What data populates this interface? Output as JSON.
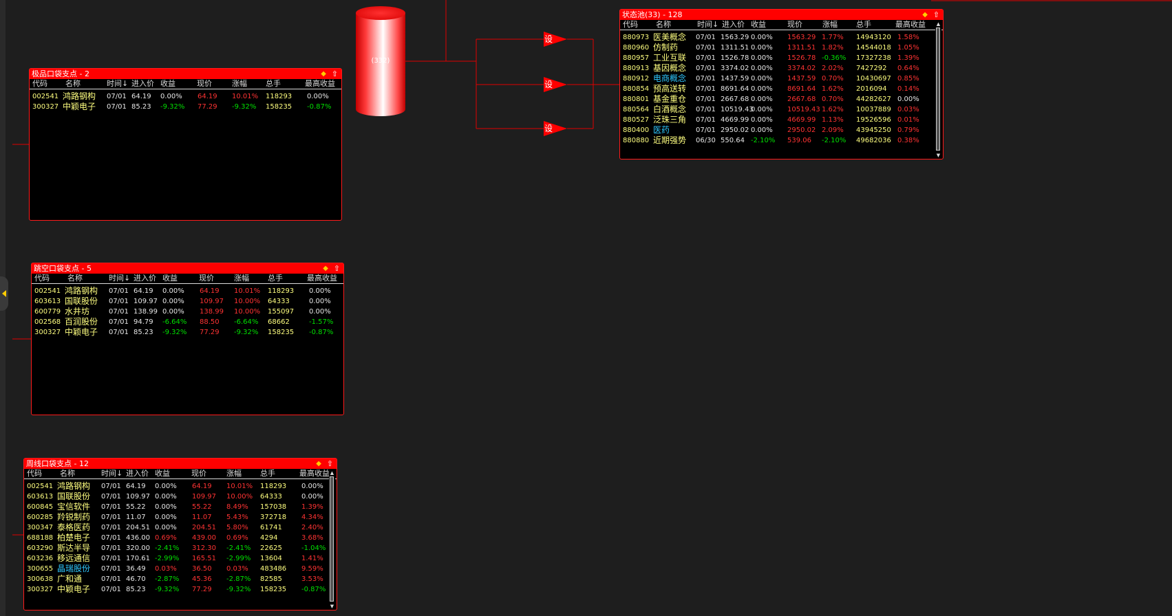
{
  "cylinder": {
    "label": "(332)"
  },
  "set_label": "设",
  "columns": [
    "代码",
    "名称",
    "时间↓",
    "进入价",
    "收益",
    "现价",
    "涨幅",
    "总手",
    "最高收益"
  ],
  "panels": [
    {
      "id": "jipin",
      "title": "极品口袋支点 - 2",
      "rows": [
        {
          "code": "002541",
          "name": "鸿路钢构",
          "time": "07/01",
          "entry": "64.19",
          "gain": "0.00%",
          "price": "64.19",
          "change": "10.01%",
          "vol": "118293",
          "max": "0.00%"
        },
        {
          "code": "300327",
          "name": "中颖电子",
          "time": "07/01",
          "entry": "85.23",
          "gain": "-9.32%",
          "price": "77.29",
          "change": "-9.32%",
          "vol": "158235",
          "max": "-0.87%"
        }
      ]
    },
    {
      "id": "tiaokong",
      "title": "跳空口袋支点 - 5",
      "rows": [
        {
          "code": "002541",
          "name": "鸿路钢构",
          "time": "07/01",
          "entry": "64.19",
          "gain": "0.00%",
          "price": "64.19",
          "change": "10.01%",
          "vol": "118293",
          "max": "0.00%"
        },
        {
          "code": "603613",
          "name": "国联股份",
          "time": "07/01",
          "entry": "109.97",
          "gain": "0.00%",
          "price": "109.97",
          "change": "10.00%",
          "vol": "64333",
          "max": "0.00%"
        },
        {
          "code": "600779",
          "name": "水井坊",
          "time": "07/01",
          "entry": "138.99",
          "gain": "0.00%",
          "price": "138.99",
          "change": "10.00%",
          "vol": "155097",
          "max": "0.00%"
        },
        {
          "code": "002568",
          "name": "百润股份",
          "time": "07/01",
          "entry": "94.79",
          "gain": "-6.64%",
          "price": "88.50",
          "change": "-6.64%",
          "vol": "68662",
          "max": "-1.57%"
        },
        {
          "code": "300327",
          "name": "中颖电子",
          "time": "07/01",
          "entry": "85.23",
          "gain": "-9.32%",
          "price": "77.29",
          "change": "-9.32%",
          "vol": "158235",
          "max": "-0.87%"
        }
      ]
    },
    {
      "id": "zhouxian",
      "title": "周线口袋支点 - 12",
      "rows": [
        {
          "code": "002541",
          "name": "鸿路钢构",
          "time": "07/01",
          "entry": "64.19",
          "gain": "0.00%",
          "price": "64.19",
          "change": "10.01%",
          "vol": "118293",
          "max": "0.00%"
        },
        {
          "code": "603613",
          "name": "国联股份",
          "time": "07/01",
          "entry": "109.97",
          "gain": "0.00%",
          "price": "109.97",
          "change": "10.00%",
          "vol": "64333",
          "max": "0.00%"
        },
        {
          "code": "600845",
          "name": "宝信软件",
          "time": "07/01",
          "entry": "55.22",
          "gain": "0.00%",
          "price": "55.22",
          "change": "8.49%",
          "vol": "157038",
          "max": "1.39%"
        },
        {
          "code": "600285",
          "name": "羚锐制药",
          "time": "07/01",
          "entry": "11.07",
          "gain": "0.00%",
          "price": "11.07",
          "change": "5.43%",
          "vol": "372718",
          "max": "4.34%"
        },
        {
          "code": "300347",
          "name": "泰格医药",
          "time": "07/01",
          "entry": "204.51",
          "gain": "0.00%",
          "price": "204.51",
          "change": "5.80%",
          "vol": "61741",
          "max": "2.40%"
        },
        {
          "code": "688188",
          "name": "柏楚电子",
          "time": "07/01",
          "entry": "436.00",
          "gain": "0.69%",
          "price": "439.00",
          "change": "0.69%",
          "vol": "4294",
          "max": "3.68%"
        },
        {
          "code": "603290",
          "name": "斯达半导",
          "time": "07/01",
          "entry": "320.00",
          "gain": "-2.41%",
          "price": "312.30",
          "change": "-2.41%",
          "vol": "22625",
          "max": "-1.04%"
        },
        {
          "code": "603236",
          "name": "移远通信",
          "time": "07/01",
          "entry": "170.61",
          "gain": "-2.99%",
          "price": "165.51",
          "change": "-2.99%",
          "vol": "13604",
          "max": "1.41%"
        },
        {
          "code": "300655",
          "name": "晶瑞股份",
          "time": "07/01",
          "entry": "36.49",
          "gain": "0.03%",
          "price": "36.50",
          "change": "0.03%",
          "vol": "483486",
          "max": "9.59%"
        },
        {
          "code": "300638",
          "name": "广和通",
          "time": "07/01",
          "entry": "46.70",
          "gain": "-2.87%",
          "price": "45.36",
          "change": "-2.87%",
          "vol": "82585",
          "max": "3.53%"
        },
        {
          "code": "300327",
          "name": "中颖电子",
          "time": "07/01",
          "entry": "85.23",
          "gain": "-9.32%",
          "price": "77.29",
          "change": "-9.32%",
          "vol": "158235",
          "max": "-0.87%"
        }
      ]
    },
    {
      "id": "zhuangtai",
      "title": "状态池(33) - 128",
      "rows": [
        {
          "code": "880973",
          "name": "医美概念",
          "time": "07/01",
          "entry": "1563.29",
          "gain": "0.00%",
          "price": "1563.29",
          "change": "1.77%",
          "vol": "14943120",
          "max": "1.58%"
        },
        {
          "code": "880960",
          "name": "仿制药",
          "time": "07/01",
          "entry": "1311.51",
          "gain": "0.00%",
          "price": "1311.51",
          "change": "1.82%",
          "vol": "14544018",
          "max": "1.05%"
        },
        {
          "code": "880957",
          "name": "工业互联",
          "time": "07/01",
          "entry": "1526.78",
          "gain": "0.00%",
          "price": "1526.78",
          "change": "-0.36%",
          "vol": "17327238",
          "max": "1.39%"
        },
        {
          "code": "880913",
          "name": "基因概念",
          "time": "07/01",
          "entry": "3374.02",
          "gain": "0.00%",
          "price": "3374.02",
          "change": "2.02%",
          "vol": "7427292",
          "max": "0.64%"
        },
        {
          "code": "880912",
          "name": "电商概念",
          "time": "07/01",
          "entry": "1437.59",
          "gain": "0.00%",
          "price": "1437.59",
          "change": "0.70%",
          "vol": "10430697",
          "max": "0.85%"
        },
        {
          "code": "880854",
          "name": "预高送转",
          "time": "07/01",
          "entry": "8691.64",
          "gain": "0.00%",
          "price": "8691.64",
          "change": "1.62%",
          "vol": "2016094",
          "max": "0.14%"
        },
        {
          "code": "880801",
          "name": "基金重仓",
          "time": "07/01",
          "entry": "2667.68",
          "gain": "0.00%",
          "price": "2667.68",
          "change": "0.70%",
          "vol": "44282627",
          "max": "0.00%"
        },
        {
          "code": "880564",
          "name": "白酒概念",
          "time": "07/01",
          "entry": "10519.43",
          "gain": "0.00%",
          "price": "10519.43",
          "change": "1.62%",
          "vol": "10037889",
          "max": "0.03%"
        },
        {
          "code": "880527",
          "name": "泛珠三角",
          "time": "07/01",
          "entry": "4669.99",
          "gain": "0.00%",
          "price": "4669.99",
          "change": "1.13%",
          "vol": "19526596",
          "max": "0.01%"
        },
        {
          "code": "880400",
          "name": "医药",
          "time": "07/01",
          "entry": "2950.02",
          "gain": "0.00%",
          "price": "2950.02",
          "change": "2.09%",
          "vol": "43945250",
          "max": "0.79%"
        },
        {
          "code": "880880",
          "name": "近期强势",
          "time": "06/30",
          "entry": "550.64",
          "gain": "-2.10%",
          "price": "539.06",
          "change": "-2.10%",
          "vol": "49682036",
          "max": "0.38%"
        }
      ]
    }
  ],
  "colors": {
    "up": "#ff3333",
    "down": "#00e000",
    "neutral": "#e8e8e8",
    "code": "#ffff80",
    "highlight_name": "#2fc8ff",
    "panel_border": "#ff1a1a",
    "title_bar": "#ff0000"
  },
  "highlight_names": [
    "电商概念",
    "医药",
    "晶瑞股份"
  ],
  "icons": {
    "pin": "diamond-icon",
    "collapse": "arrow-up-icon"
  }
}
